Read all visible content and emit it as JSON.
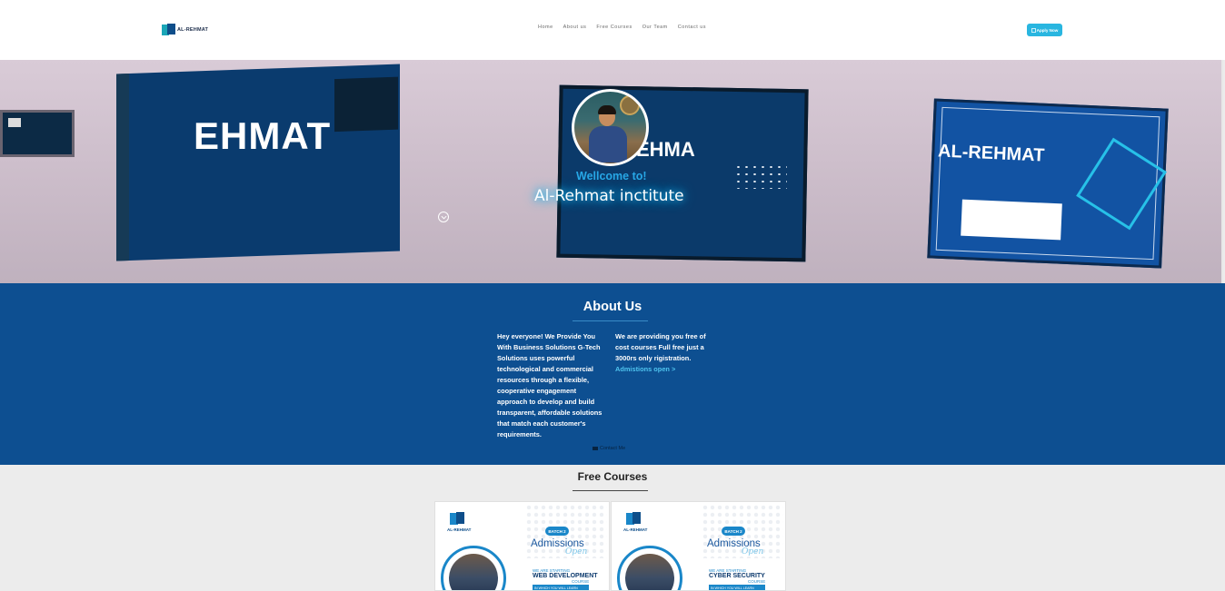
{
  "navbar": {
    "logo_text": "AL-REHMAT",
    "links": [
      "Home",
      "About us",
      "Free Courses",
      "Our Team",
      "Contact us"
    ],
    "apply_label": "Apply Now",
    "apply_icon": "apply-icon"
  },
  "hero": {
    "welcome": "Wellcome to!",
    "name": "Al-Rehmat inctitute",
    "board_text_1": "EHMAT",
    "board_text_2": "EHMA",
    "board_text_3": "AL-REHMAT",
    "scroll_icon": "chevron-down-circle-icon"
  },
  "about": {
    "title": "About Us",
    "left_text": "Hey everyone! We Provide You With Business Solutions G-Tech Solutions uses powerful technological and commercial resources through a flexible, cooperative engagement approach to develop and build transparent, affordable solutions that match each customer's requirements.",
    "right_text": "We are providing you free of cost courses Full free just a 3000rs only rigistration.",
    "admissions_link": "Admistions open >",
    "contact_label": "Contact Me"
  },
  "courses": {
    "title": "Free Courses",
    "cards": [
      {
        "logo_name": "AL-REHMAT",
        "batch": "BATCH 2",
        "admissions": "Admissions",
        "open": "Open",
        "starting": "WE ARE STARTING",
        "course": "WEB DEVELOPMENT",
        "course_sub": "COURSE",
        "strip": "IN WHICH YOU WILL LEARN"
      },
      {
        "logo_name": "AL-REHMAT",
        "batch": "BATCH 2",
        "admissions": "Admissions",
        "open": "Open",
        "starting": "WE ARE STARTING",
        "course": "CYBER SECURITY",
        "course_sub": "COURSE",
        "strip": "IN WHICH YOU WILL LEARN"
      }
    ]
  },
  "colors": {
    "accent": "#29b6e0",
    "about_bg": "#0d4f91",
    "link": "#4fc4ef"
  }
}
